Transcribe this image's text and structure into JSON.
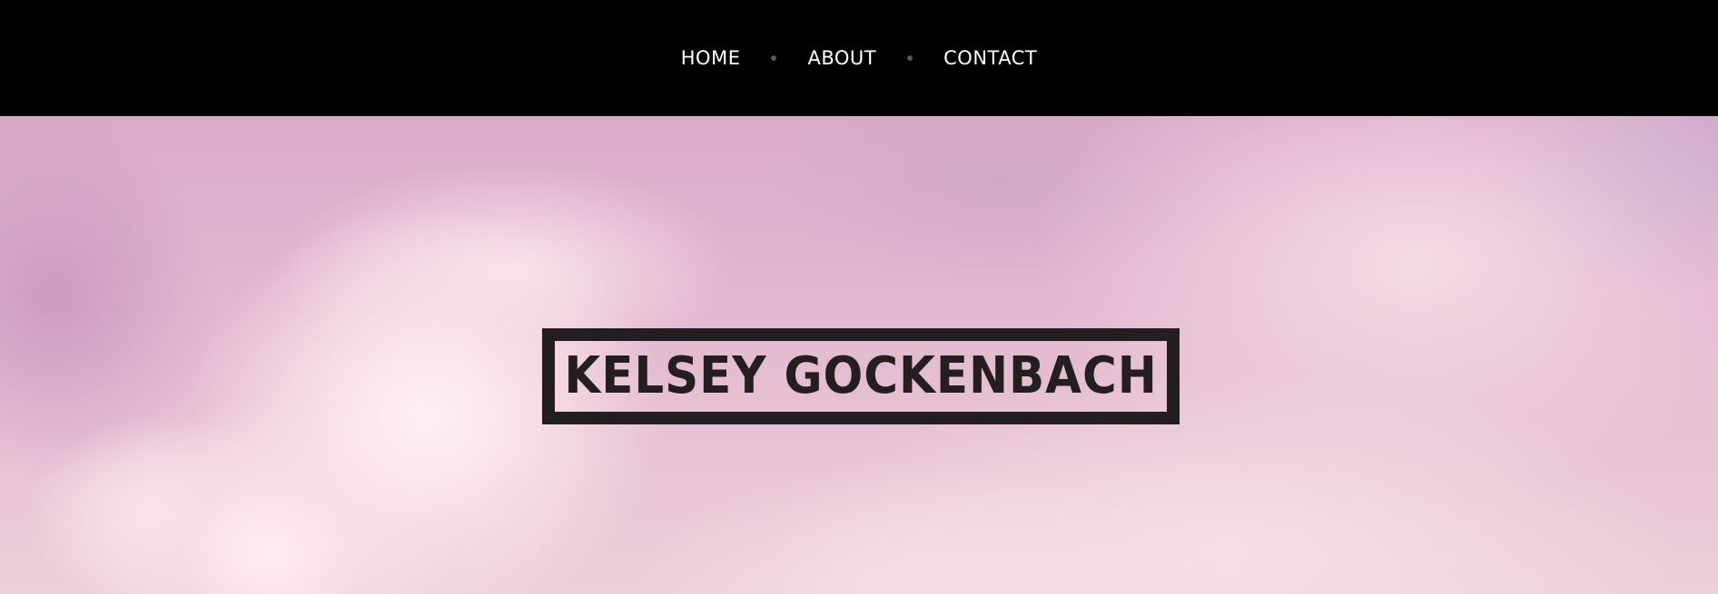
{
  "nav": {
    "items": [
      {
        "label": "HOME"
      },
      {
        "label": "ABOUT"
      },
      {
        "label": "CONTACT"
      }
    ]
  },
  "hero": {
    "title": "KELSEY GOCKENBACH"
  },
  "colors": {
    "topbar": "#000000",
    "nav_text": "#ffffff",
    "separator": "#555555",
    "title": "#231f20",
    "sky_pink": "#e2b8cf"
  }
}
